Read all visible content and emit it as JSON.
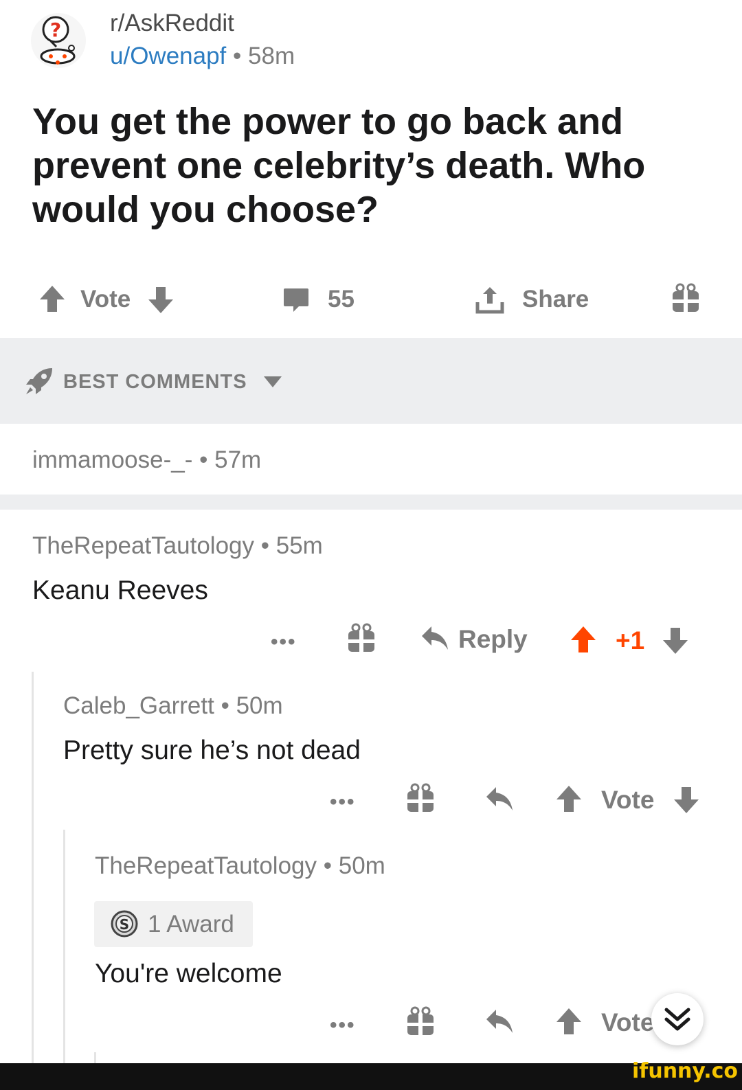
{
  "post": {
    "subreddit": "r/AskReddit",
    "author": "u/Owenapf",
    "separator": "•",
    "age": "58m",
    "title": "You get the power to go back and prevent one celebrity’s death. Who would you choose?",
    "actions": {
      "vote_label": "Vote",
      "comment_count": "55",
      "share_label": "Share"
    }
  },
  "comments_sort": {
    "label": "BEST COMMENTS"
  },
  "comments": {
    "collapsed": {
      "author": "immamoose-_-",
      "age": "57m"
    },
    "top": {
      "author": "TheRepeatTautology",
      "age": "55m",
      "body": "Keanu Reeves",
      "more": "•••",
      "reply_label": "Reply",
      "score": "+1"
    },
    "reply1": {
      "author": "Caleb_Garrett",
      "age": "50m",
      "body": "Pretty sure he’s not dead",
      "more": "•••",
      "vote_label": "Vote"
    },
    "reply2": {
      "author": "TheRepeatTautology",
      "age": "50m",
      "award": "1 Award",
      "body": "You're welcome",
      "more": "•••",
      "vote_label": "Vote"
    }
  },
  "watermark": "ifunny.co",
  "icons": {
    "subreddit_avatar": "askreddit-snoo-icon",
    "upvote": "arrow-up-icon",
    "downvote": "arrow-down-icon",
    "comments": "comment-bubble-icon",
    "share": "share-icon",
    "award": "gift-icon",
    "sort": "rocket-icon",
    "reply": "reply-arrow-icon",
    "silver_award": "silver-award-icon",
    "scroll": "double-chevron-down-icon"
  },
  "colors": {
    "accent_upvote": "#ff4500",
    "link_blue": "#2c7cc1",
    "muted": "#7c7c7c",
    "sort_bar_bg": "#edeef0",
    "watermark": "#f5c400"
  }
}
